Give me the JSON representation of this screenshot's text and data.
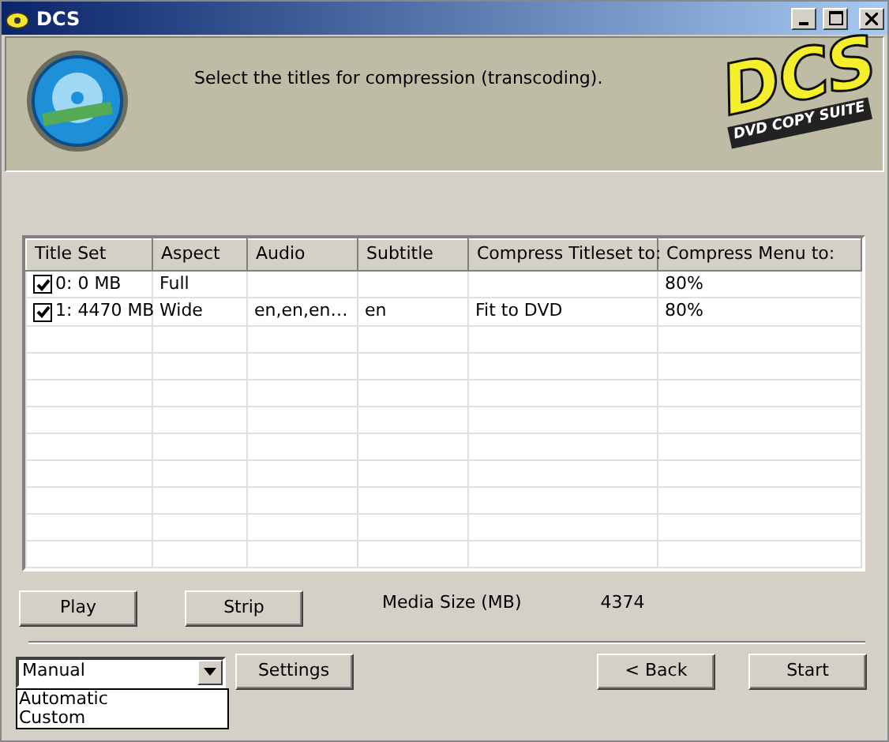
{
  "window": {
    "title": "DCS"
  },
  "header": {
    "instruction": "Select the titles for compression (transcoding).",
    "logo_text": "DCS",
    "logo_subtext": "DVD COPY SUITE"
  },
  "table": {
    "columns": [
      "Title Set",
      "Aspect",
      "Audio",
      "Subtitle",
      "Compress Titleset to:",
      "Compress Menu to:"
    ],
    "rows": [
      {
        "checked": true,
        "cells": [
          "0: 0 MB",
          "Full",
          "",
          "",
          "",
          "80%"
        ]
      },
      {
        "checked": true,
        "cells": [
          "1: 4470 MB",
          "Wide",
          "en,en,en…",
          "en",
          "Fit to DVD",
          "80%"
        ]
      }
    ]
  },
  "buttons": [
    "Play",
    "Strip"
  ],
  "media_size": {
    "label": "Media Size (MB)",
    "value": "4374"
  },
  "mode_select": {
    "value": "Manual",
    "expanded": true,
    "options": [
      "Automatic",
      "Custom"
    ]
  },
  "settings_button": "Settings",
  "nav_buttons": [
    "< Back",
    "Start"
  ]
}
